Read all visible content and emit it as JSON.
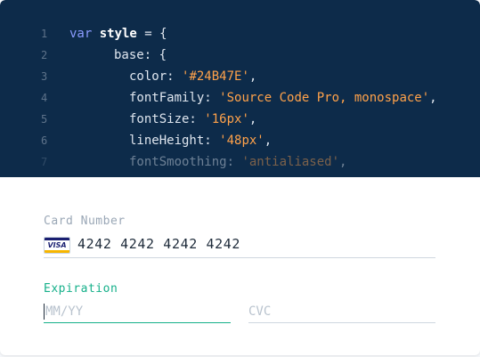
{
  "code": {
    "lines": [
      {
        "n": "1",
        "parts": [
          {
            "t": "var ",
            "c": "kw"
          },
          {
            "t": "style",
            "c": "bold"
          },
          {
            "t": " = {",
            "c": ""
          }
        ]
      },
      {
        "n": "2",
        "parts": [
          {
            "t": "base: {",
            "c": ""
          }
        ]
      },
      {
        "n": "3",
        "parts": [
          {
            "t": "color: ",
            "c": ""
          },
          {
            "t": "'#24B47E'",
            "c": "str"
          },
          {
            "t": ",",
            "c": ""
          }
        ]
      },
      {
        "n": "4",
        "parts": [
          {
            "t": "fontFamily: ",
            "c": ""
          },
          {
            "t": "'Source Code Pro, monospace'",
            "c": "str"
          },
          {
            "t": ",",
            "c": ""
          }
        ]
      },
      {
        "n": "5",
        "parts": [
          {
            "t": "fontSize: ",
            "c": ""
          },
          {
            "t": "'16px'",
            "c": "str"
          },
          {
            "t": ",",
            "c": ""
          }
        ]
      },
      {
        "n": "6",
        "parts": [
          {
            "t": "lineHeight: ",
            "c": ""
          },
          {
            "t": "'48px'",
            "c": "str"
          },
          {
            "t": ",",
            "c": ""
          }
        ]
      },
      {
        "n": "7",
        "parts": [
          {
            "t": "fontSmoothing: ",
            "c": ""
          },
          {
            "t": "'antialiased'",
            "c": "str"
          },
          {
            "t": ",",
            "c": ""
          }
        ]
      }
    ]
  },
  "form": {
    "card_number_label": "Card Number",
    "card_brand": "VISA",
    "card_number_value": "4242 4242 4242 4242",
    "expiration_label": "Expiration",
    "expiration_placeholder": "MM/YY",
    "cvc_placeholder": "CVC"
  },
  "colors": {
    "code_background": "#0d2b4a",
    "accent_focus": "#16b08a",
    "string": "#ffa24a",
    "keyword": "#8a9bff"
  }
}
